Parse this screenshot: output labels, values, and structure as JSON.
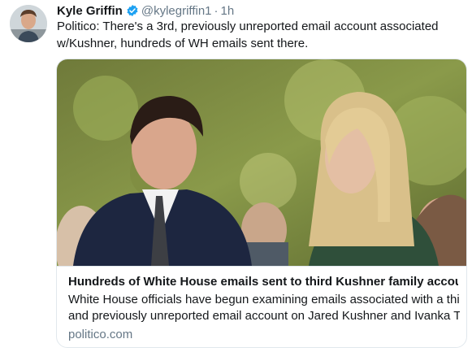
{
  "author": {
    "display_name": "Kyle Griffin",
    "handle": "@kylegriffin1",
    "separator": "·",
    "time": "1h",
    "verified": true,
    "verified_color": "#1da1f2"
  },
  "tweet": {
    "text": "Politico: There's a 3rd, previously unreported email account associated w/Kushner, hundreds of WH emails sent there."
  },
  "card": {
    "title": "Hundreds of White House emails sent to third Kushner family account",
    "description_line1": "White House officials have begun examining emails associated with a third",
    "description_line2": "and previously unreported email account on Jared Kushner and Ivanka T...",
    "domain": "politico.com",
    "image_icon": "photo-of-jared-kushner-and-ivanka-trump"
  },
  "colors": {
    "text": "#14171a",
    "secondary": "#657786",
    "border": "#e1e8ed"
  }
}
